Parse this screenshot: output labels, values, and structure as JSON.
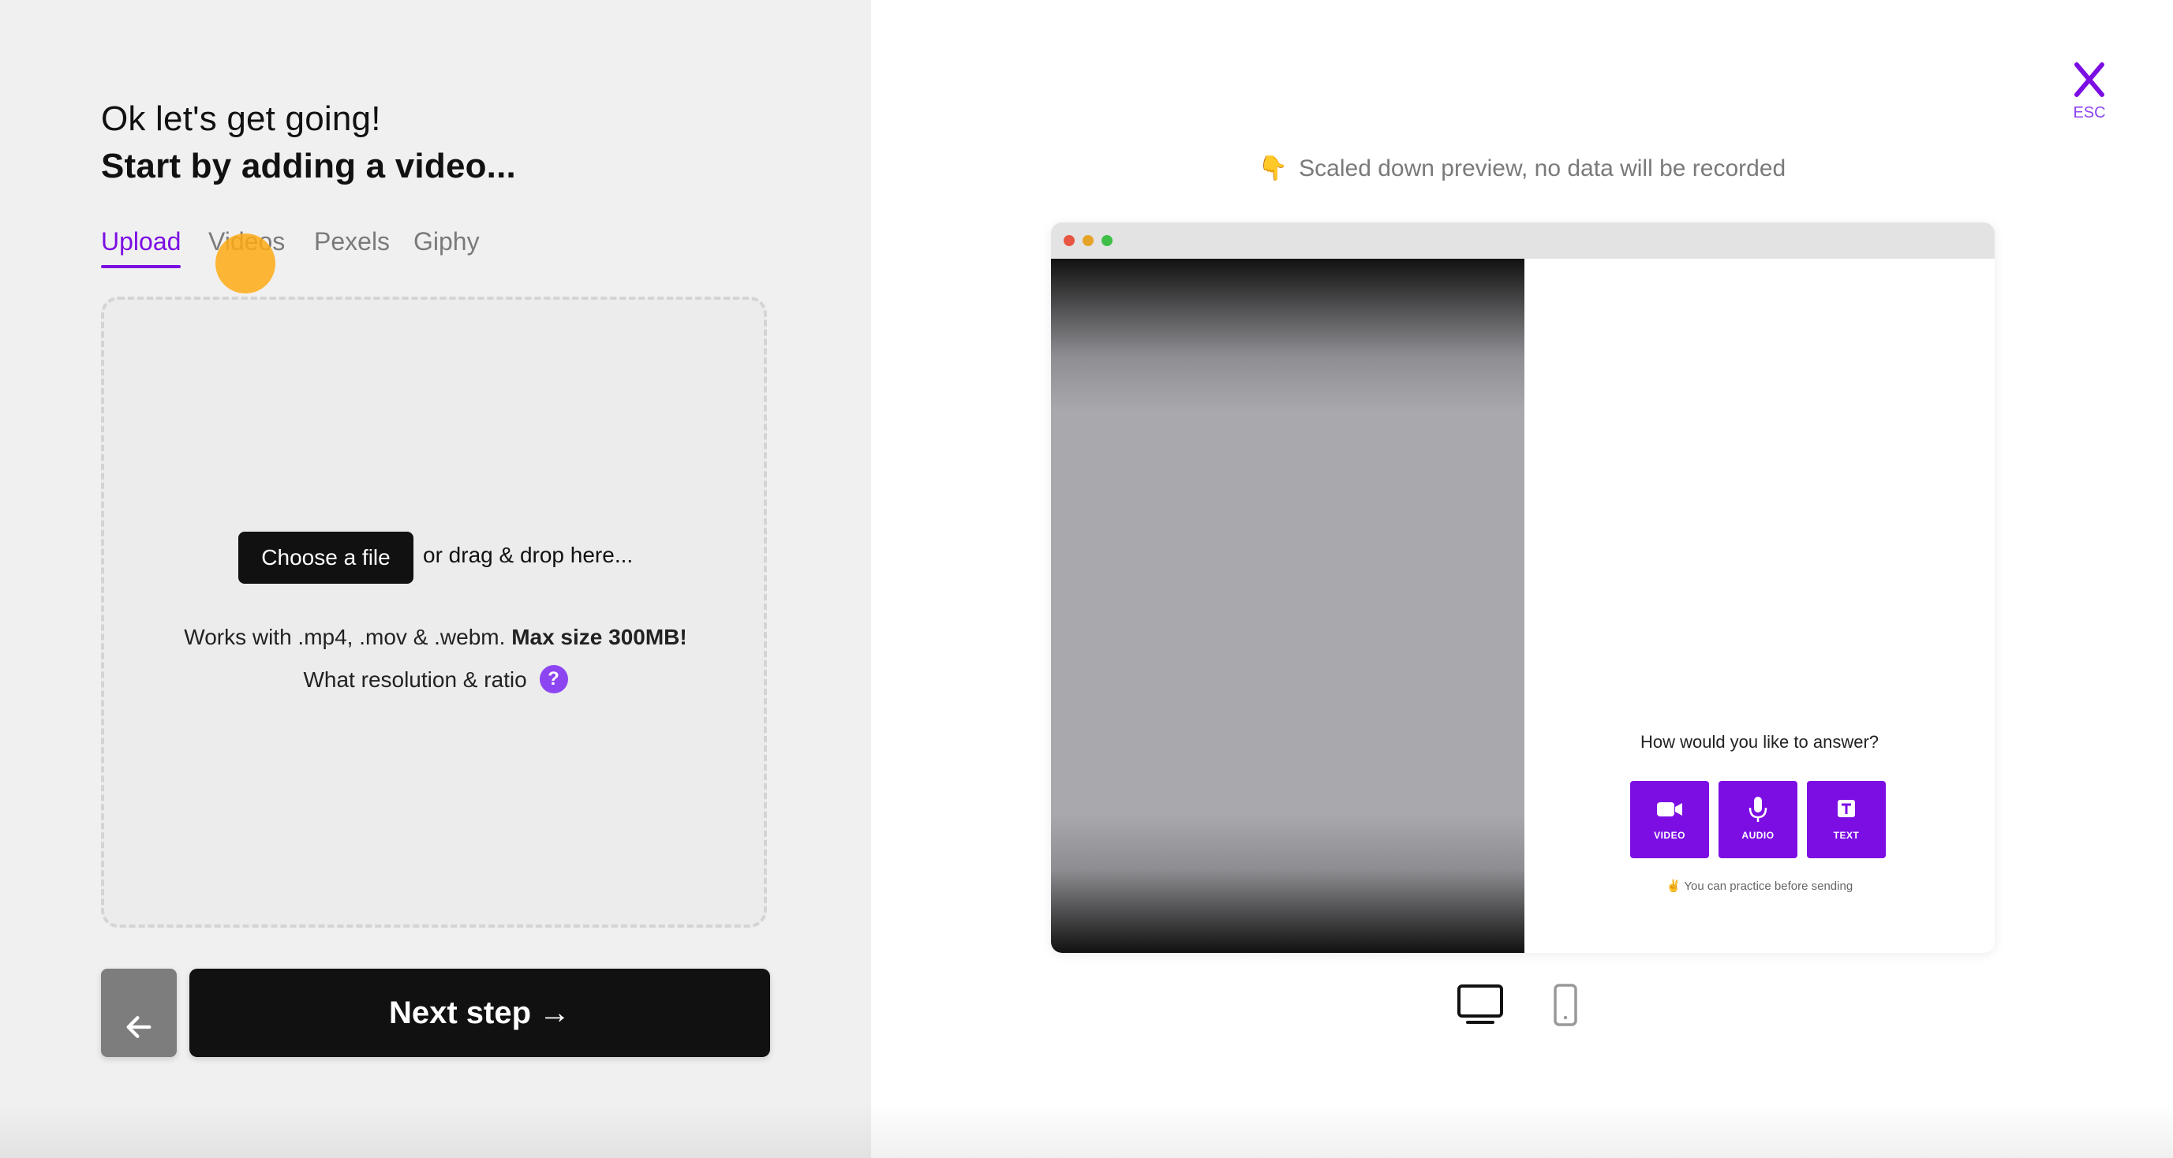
{
  "left": {
    "heading_line1": "Ok let's get going!",
    "heading_line2": "Start by adding a video...",
    "tabs": [
      {
        "label": "Upload",
        "active": true
      },
      {
        "label": "Videos",
        "active": false
      },
      {
        "label": "Pexels",
        "active": false
      },
      {
        "label": "Giphy",
        "active": false
      }
    ],
    "dropzone": {
      "choose_button": "Choose a file",
      "drag_text": "or drag & drop here...",
      "works_with": "Works with .mp4, .mov & .webm.",
      "max_size": "Max size 300MB!",
      "resolution_text": "What resolution & ratio",
      "help_symbol": "?"
    },
    "back_button_icon": "arrow-left-icon",
    "next_button_label": "Next step",
    "next_button_arrow": "→"
  },
  "right": {
    "close_label": "ESC",
    "preview_emoji": "👇",
    "preview_note": "Scaled down preview, no data will be recorded",
    "preview": {
      "question": "How would you like to answer?",
      "buttons": [
        {
          "label": "VIDEO",
          "icon": "video-camera-icon"
        },
        {
          "label": "AUDIO",
          "icon": "microphone-icon"
        },
        {
          "label": "TEXT",
          "icon": "text-icon"
        }
      ],
      "practice_emoji": "✌️",
      "practice_text": "You can practice before sending"
    },
    "device_toggle": [
      {
        "icon": "desktop-icon",
        "active": true
      },
      {
        "icon": "mobile-icon",
        "active": false
      }
    ]
  },
  "colors": {
    "accent": "#7c0ee3",
    "help_badge": "#8d45f2",
    "left_bg": "#f0f0f0",
    "dark_button": "#111111",
    "back_button": "#7d7d7d",
    "cursor_dot": "#ffaa14"
  }
}
